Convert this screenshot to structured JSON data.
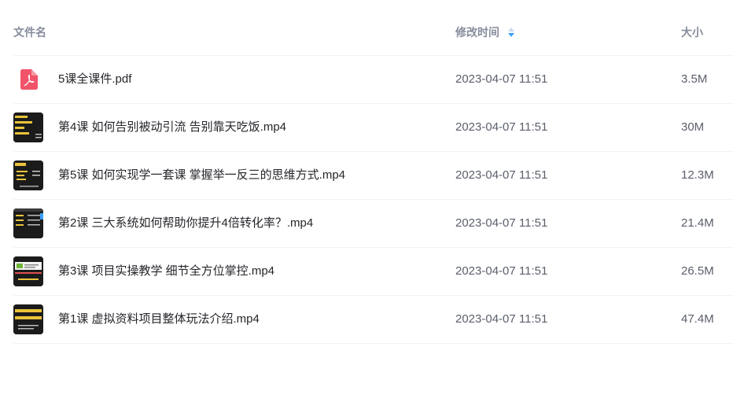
{
  "header": {
    "name_label": "文件名",
    "time_label": "修改时间",
    "size_label": "大小",
    "sort_icon": "sort-icon"
  },
  "colors": {
    "pdf_icon": "#f1546a",
    "sort_active": "#3aa0ff",
    "thumb_dark": "#1b1b1b",
    "thumb_yellow": "#e9c23a"
  },
  "files": [
    {
      "name": "5课全课件.pdf",
      "time": "2023-04-07 11:51",
      "size": "3.5M",
      "icon": "pdf-icon"
    },
    {
      "name": "第4课 如何告别被动引流 告别靠天吃饭.mp4",
      "time": "2023-04-07 11:51",
      "size": "30M",
      "icon": "video-thumbnail"
    },
    {
      "name": "第5课 如何实现学一套课 掌握举一反三的思维方式.mp4",
      "time": "2023-04-07 11:51",
      "size": "12.3M",
      "icon": "video-thumbnail"
    },
    {
      "name": "第2课 三大系统如何帮助你提升4倍转化率？.mp4",
      "time": "2023-04-07 11:51",
      "size": "21.4M",
      "icon": "video-thumbnail"
    },
    {
      "name": "第3课 项目实操教学 细节全方位掌控.mp4",
      "time": "2023-04-07 11:51",
      "size": "26.5M",
      "icon": "video-thumbnail"
    },
    {
      "name": "第1课 虚拟资料项目整体玩法介绍.mp4",
      "time": "2023-04-07 11:51",
      "size": "47.4M",
      "icon": "video-thumbnail"
    }
  ]
}
